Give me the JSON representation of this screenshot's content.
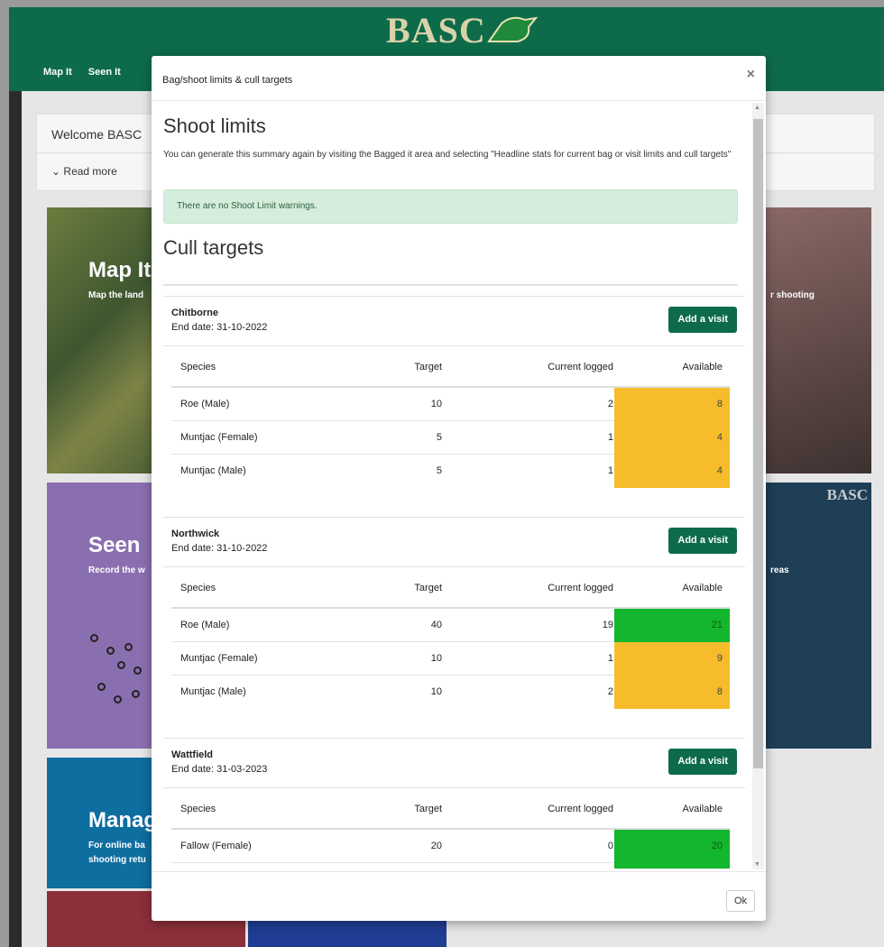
{
  "app": {
    "logo_text": "BASC",
    "nav": [
      "Map It",
      "Seen It"
    ],
    "welcome_title": "Welcome BASC",
    "read_more": "Read more",
    "tiles": {
      "map_title": "Map It",
      "map_sub": "Map the land",
      "seen_title": "Seen",
      "seen_sub": "Record the w",
      "manage_title": "Manag",
      "manage_sub_1": "For online ba",
      "manage_sub_2": "shooting retu",
      "deer_sub": "r shooting",
      "map2_brand": "BASC",
      "map2_sub": "reas"
    }
  },
  "modal": {
    "title": "Bag/shoot limits & cull targets",
    "close": "×",
    "shoot_heading": "Shoot limits",
    "intro": "You can generate this summary again by visiting the Bagged it area and selecting \"Headline stats for current bag or visit limits and cull targets\"",
    "alert": "There are no Shoot Limit warnings.",
    "cull_heading": "Cull targets",
    "ok_label": "Ok",
    "columns": {
      "species": "Species",
      "target": "Target",
      "current": "Current logged",
      "available": "Available"
    },
    "add_visit_label": "Add a visit",
    "sites": [
      {
        "name": "Chitborne",
        "end_date": "End date: 31-10-2022",
        "rows": [
          {
            "species": "Roe (Male)",
            "target": "10",
            "current": "2",
            "available": "8",
            "status": "warn"
          },
          {
            "species": "Muntjac (Female)",
            "target": "5",
            "current": "1",
            "available": "4",
            "status": "warn"
          },
          {
            "species": "Muntjac (Male)",
            "target": "5",
            "current": "1",
            "available": "4",
            "status": "warn"
          }
        ]
      },
      {
        "name": "Northwick",
        "end_date": "End date: 31-10-2022",
        "rows": [
          {
            "species": "Roe (Male)",
            "target": "40",
            "current": "19",
            "available": "21",
            "status": "good"
          },
          {
            "species": "Muntjac (Female)",
            "target": "10",
            "current": "1",
            "available": "9",
            "status": "warn"
          },
          {
            "species": "Muntjac (Male)",
            "target": "10",
            "current": "2",
            "available": "8",
            "status": "warn"
          }
        ]
      },
      {
        "name": "Wattfield",
        "end_date": "End date: 31-03-2023",
        "rows": [
          {
            "species": "Fallow (Female)",
            "target": "20",
            "current": "0",
            "available": "20",
            "status": "good"
          }
        ]
      }
    ]
  },
  "colors": {
    "brand_green": "#0d6b4a",
    "warn": "#f6bc2b",
    "good": "#13b62c",
    "alert_bg": "#d4eddc"
  }
}
